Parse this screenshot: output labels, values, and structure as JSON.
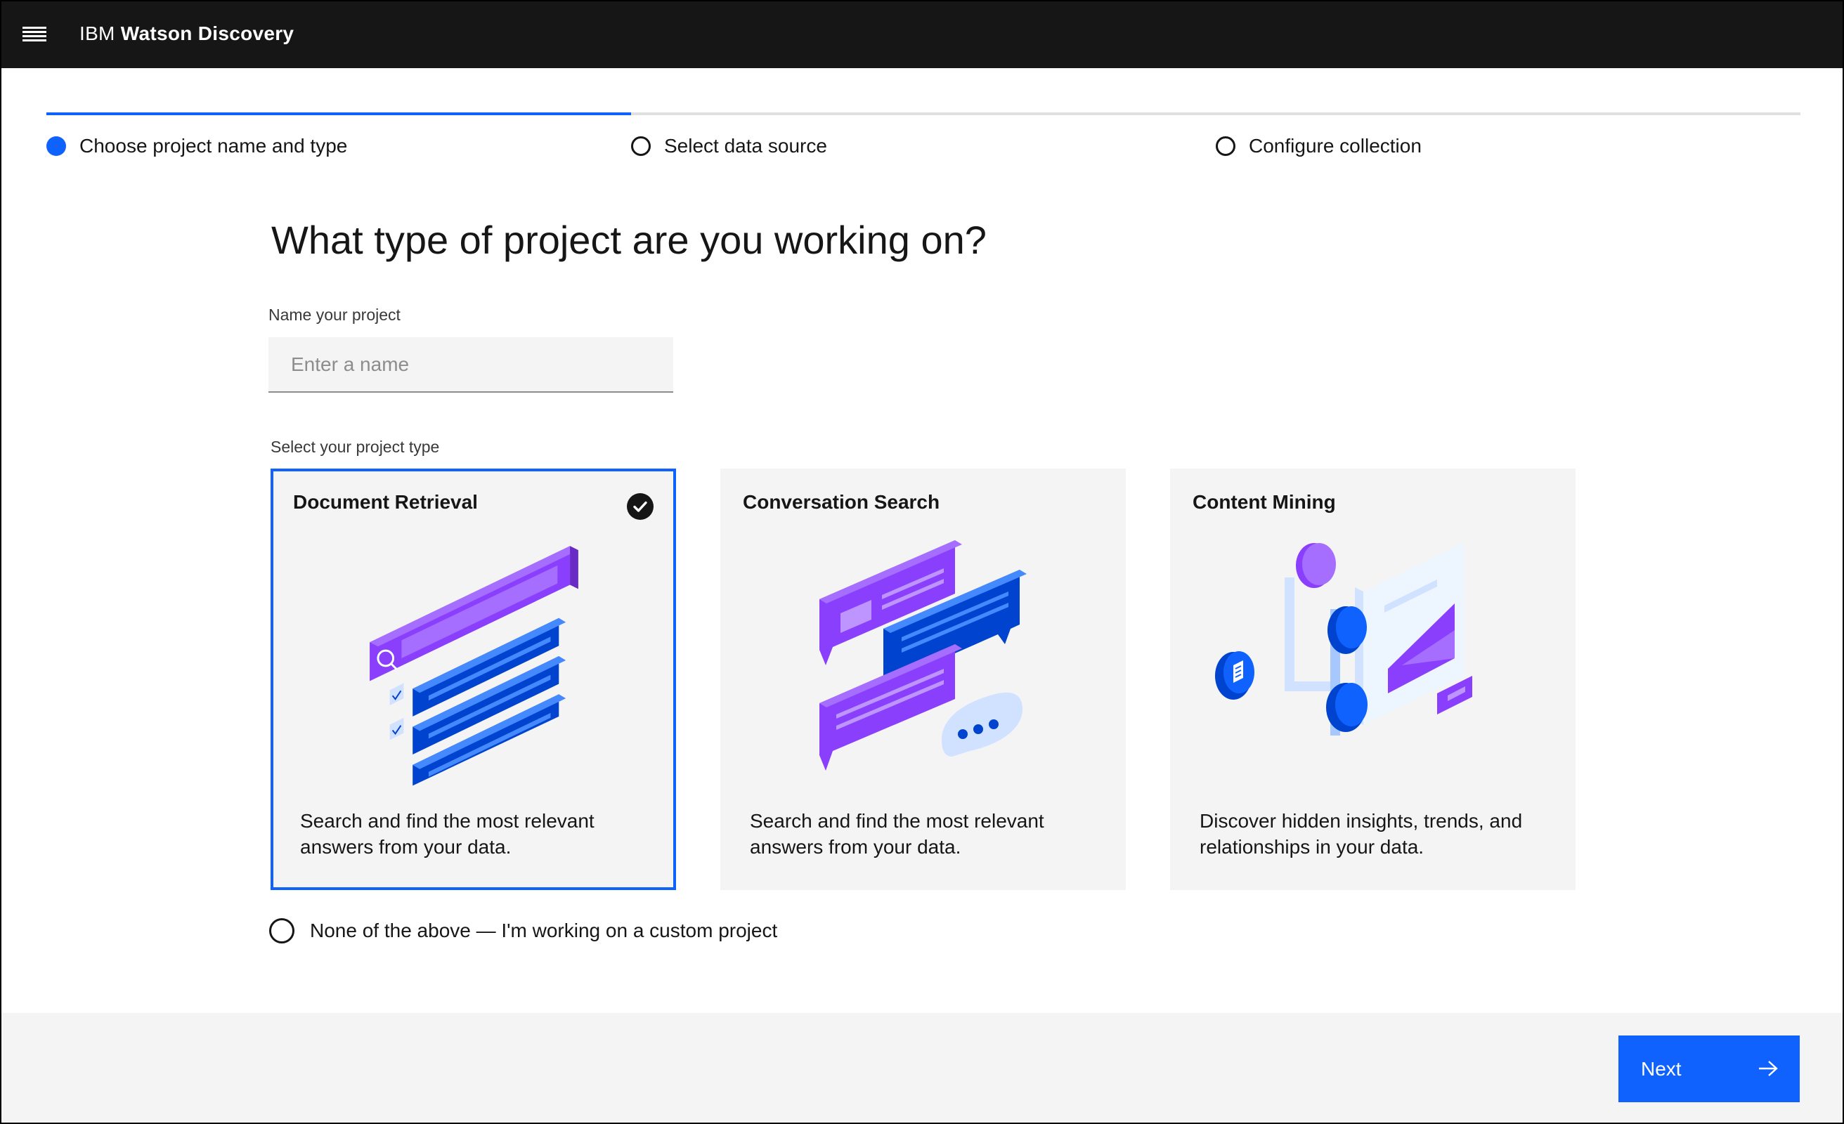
{
  "header": {
    "brand_prefix": "IBM",
    "brand_name": "Watson Discovery",
    "menu_icon": "hamburger-menu-icon"
  },
  "progress": {
    "steps": [
      {
        "label": "Choose project name and type",
        "state": "current"
      },
      {
        "label": "Select data source",
        "state": "incomplete"
      },
      {
        "label": "Configure collection",
        "state": "incomplete"
      }
    ],
    "completed_fraction": 0.333
  },
  "main": {
    "heading": "What type of project are you working on?",
    "name_label": "Name your project",
    "name_placeholder": "Enter a name",
    "name_value": "",
    "type_label": "Select your project type",
    "tiles": [
      {
        "title": "Document Retrieval",
        "description": "Search and find the most relevant answers from your data.",
        "selected": true,
        "icon": "document-retrieval-illustration"
      },
      {
        "title": "Conversation Search",
        "description": "Search and find the most relevant answers from your data.",
        "selected": false,
        "icon": "conversation-search-illustration"
      },
      {
        "title": "Content Mining",
        "description": "Discover hidden insights, trends, and relationships in your data.",
        "selected": false,
        "icon": "content-mining-illustration"
      }
    ],
    "custom_option": "None of the above — I'm working on a custom project"
  },
  "footer": {
    "next_label": "Next",
    "next_icon": "arrow-right-icon"
  },
  "colors": {
    "accent": "#0f62fe",
    "header_bg": "#161616",
    "tile_bg": "#f4f4f4",
    "purple": "#8a3ffc",
    "blue": "#0043ce"
  }
}
